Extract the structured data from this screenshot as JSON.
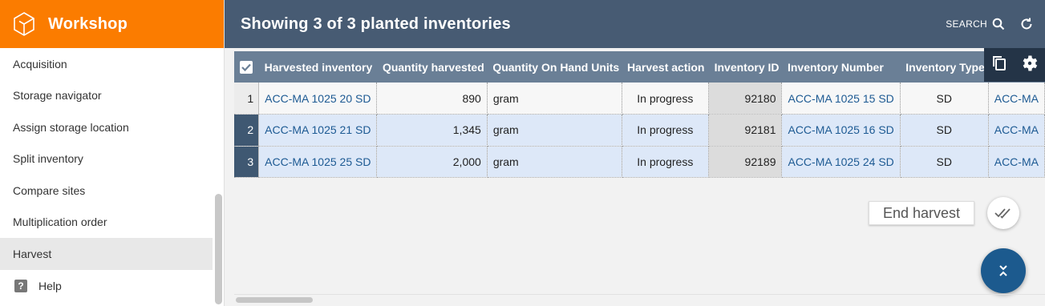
{
  "app": {
    "title": "Workshop"
  },
  "sidebar": {
    "items": [
      {
        "label": "Acquisition"
      },
      {
        "label": "Storage navigator"
      },
      {
        "label": "Assign storage location"
      },
      {
        "label": "Split inventory"
      },
      {
        "label": "Compare sites"
      },
      {
        "label": "Multiplication order"
      },
      {
        "label": "Harvest",
        "active": true
      }
    ],
    "help_label": "Help"
  },
  "header": {
    "title": "Showing 3 of 3 planted inventories",
    "search_label": "SEARCH"
  },
  "grid": {
    "columns": [
      "Harvested inventory",
      "Quantity harvested",
      "Quantity On Hand Units",
      "Harvest action",
      "Inventory ID",
      "Inventory Number",
      "Inventory Type"
    ],
    "rows": [
      {
        "n": "1",
        "harvested_inventory": "ACC-MA 1025 20 SD",
        "quantity": "890",
        "units": "gram",
        "action": "In progress",
        "id": "92180",
        "inv_number": "ACC-MA 1025 15 SD",
        "type": "SD",
        "extra": "ACC-MA"
      },
      {
        "n": "2",
        "harvested_inventory": "ACC-MA 1025 21 SD",
        "quantity": "1,345",
        "units": "gram",
        "action": "In progress",
        "id": "92181",
        "inv_number": "ACC-MA 1025 16 SD",
        "type": "SD",
        "extra": "ACC-MA"
      },
      {
        "n": "3",
        "harvested_inventory": "ACC-MA 1025 25 SD",
        "quantity": "2,000",
        "units": "gram",
        "action": "In progress",
        "id": "92189",
        "inv_number": "ACC-MA 1025 24 SD",
        "type": "SD",
        "extra": "ACC-MA"
      }
    ]
  },
  "actions": {
    "end_harvest_label": "End harvest"
  },
  "colors": {
    "brand": "#fb7c00",
    "header": "#475b73",
    "grid_header": "#6a7f96",
    "fab": "#1c5a8e"
  }
}
